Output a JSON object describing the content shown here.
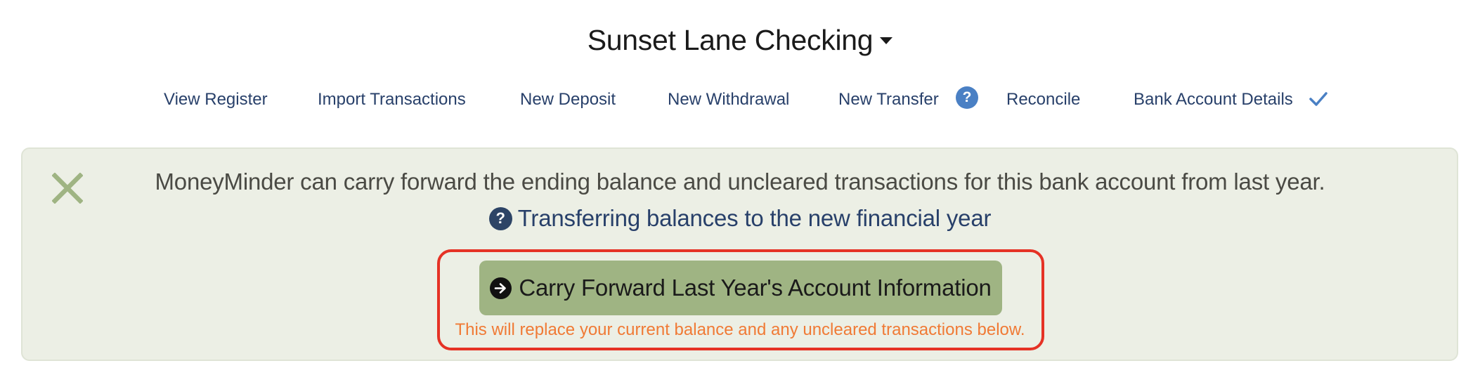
{
  "account": {
    "title": "Sunset Lane Checking"
  },
  "nav": {
    "items": [
      {
        "label": "View Register"
      },
      {
        "label": "Import Transactions"
      },
      {
        "label": "New Deposit"
      },
      {
        "label": "New Withdrawal"
      },
      {
        "label": "New Transfer"
      },
      {
        "label": "Reconcile"
      },
      {
        "label": "Bank Account Details"
      }
    ],
    "help_glyph": "?"
  },
  "banner": {
    "message": "MoneyMinder can carry forward the ending balance and uncleared transactions for this bank account from last year.",
    "help_link": "Transferring balances to the new financial year",
    "help_glyph": "?",
    "button_label": "Carry Forward Last Year's Account Information",
    "warning": "This will replace your current balance and any uncleared transactions below."
  },
  "colors": {
    "nav_text": "#28406a",
    "banner_bg": "#ecefe5",
    "button_bg": "#9fb483",
    "warning_text": "#f07a35",
    "highlight_border": "#e53225",
    "close_icon": "#9fb483"
  },
  "icons": [
    "caret-down-icon",
    "help-icon",
    "check-icon",
    "close-icon",
    "arrow-right-circle-icon"
  ]
}
